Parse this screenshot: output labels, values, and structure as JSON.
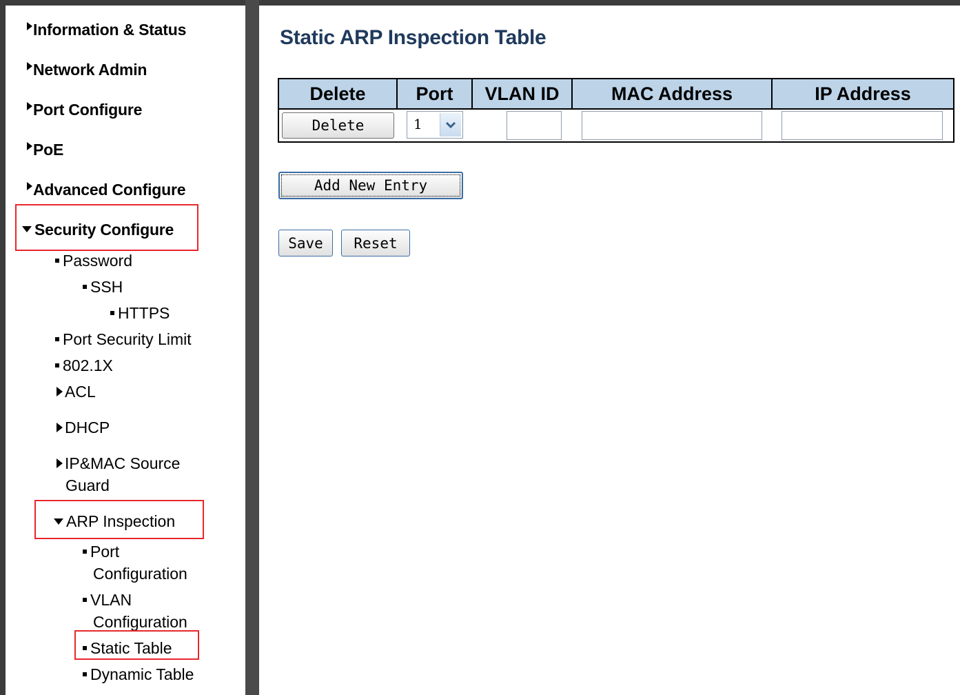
{
  "sidebar": {
    "information_status": "Information & Status",
    "network_admin": "Network Admin",
    "port_configure": "Port Configure",
    "poe": "PoE",
    "advanced_configure": "Advanced Configure",
    "security_configure": "Security Configure",
    "password": "Password",
    "ssh": "SSH",
    "https": "HTTPS",
    "port_security_limit": "Port Security Limit",
    "dot1x": "802.1X",
    "acl": "ACL",
    "dhcp": "DHCP",
    "ipmac_line1": "IP&MAC Source",
    "ipmac_line2": "Guard",
    "arp_inspection": "ARP Inspection",
    "port_configuration_line1": "Port",
    "port_configuration_line2": "Configuration",
    "vlan_configuration_line1": "VLAN",
    "vlan_configuration_line2": "Configuration",
    "static_table": "Static Table",
    "dynamic_table": "Dynamic Table"
  },
  "main": {
    "title": "Static ARP Inspection Table",
    "table": {
      "headers": [
        "Delete",
        "Port",
        "VLAN ID",
        "MAC Address",
        "IP Address"
      ],
      "row": {
        "delete_button": "Delete",
        "port_value": "1",
        "vlan_id": "",
        "mac_address": "",
        "ip_address": ""
      }
    },
    "add_new_entry": "Add New Entry",
    "save": "Save",
    "reset": "Reset"
  },
  "colors": {
    "highlight": "#e8262b",
    "header_bg": "#bcd3e8",
    "title": "#1f3a5c"
  }
}
